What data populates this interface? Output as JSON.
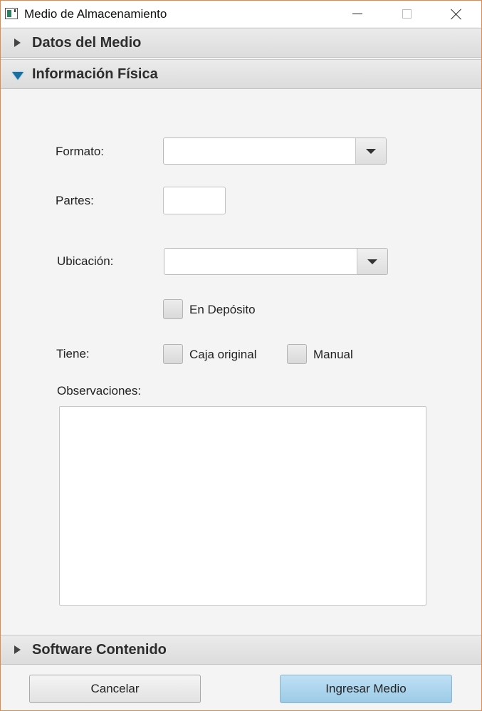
{
  "window": {
    "title": "Medio de Almacenamiento",
    "controls": [
      "minimize-icon",
      "maximize-icon",
      "close-icon"
    ]
  },
  "panes": [
    {
      "label": "Datos del Medio",
      "expanded": false
    },
    {
      "label": "Información Física",
      "expanded": true
    },
    {
      "label": "Software Contenido",
      "expanded": false
    }
  ],
  "form": {
    "formato_label": "Formato:",
    "formato_value": "",
    "partes_label": "Partes:",
    "partes_value": "",
    "ubicacion_label": "Ubicación:",
    "ubicacion_value": "",
    "en_deposito_label": "En Depósito",
    "en_deposito_checked": false,
    "tiene_label": "Tiene:",
    "caja_original_label": "Caja original",
    "caja_original_checked": false,
    "manual_label": "Manual",
    "manual_checked": false,
    "observaciones_label": "Observaciones:",
    "observaciones_value": ""
  },
  "footer": {
    "cancel_label": "Cancelar",
    "submit_label": "Ingresar Medio"
  },
  "colors": {
    "window_border": "#e5894b",
    "accent": "#1a6fa0",
    "primary_button": "#aed6ee"
  }
}
